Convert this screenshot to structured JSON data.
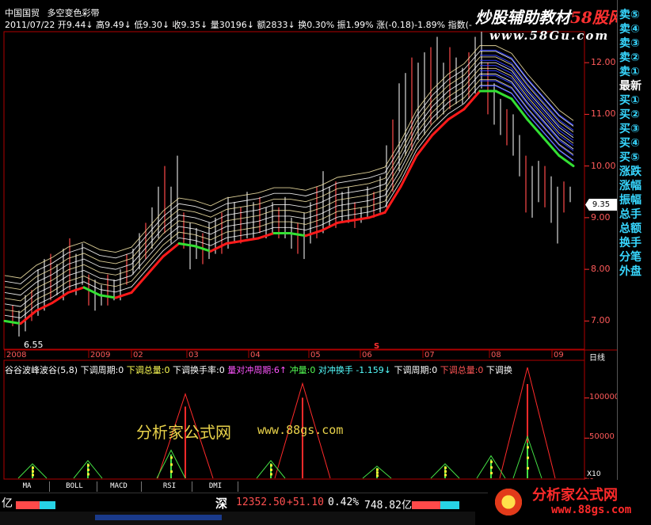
{
  "header": {
    "stock_name": "中国国贸",
    "indicator_name": "多空变色彩带",
    "date": "2011/07/22",
    "quote_parts": [
      "开9.44↓",
      "高9.49↓",
      "低9.30↓",
      "收9.35↓",
      "量30196↓",
      "额2833↓",
      "换0.30%",
      "振1.99%",
      "涨(-0.18)-1.89%",
      "指数(-"
    ]
  },
  "watermark_top": {
    "line1": "炒股辅助教材",
    "line1_red": "58股网",
    "line2": "www.58Gu.com"
  },
  "watermark_mid": {
    "brand": "分析家公式网",
    "url": "www.88gs.com"
  },
  "watermark_bottom": {
    "brand": "分析家公式网",
    "url": "www.88gs.com"
  },
  "price_axis": {
    "ticks": [
      "12.00",
      "11.00",
      "10.00",
      "9.00",
      "8.00",
      "7.00"
    ],
    "current": "9.35"
  },
  "low_label": "6.55",
  "date_axis": {
    "labels": [
      "2008",
      "2009",
      "02",
      "03",
      "04",
      "05",
      "06",
      "07",
      "08",
      "09"
    ],
    "period": "日线"
  },
  "marker_s": "S",
  "indicator_line": {
    "name": "谷谷波峰波谷(5,8)",
    "parts": [
      {
        "text": "下调周期:0",
        "color": "#ffffff"
      },
      {
        "text": "下调总量:0",
        "color": "#ffff55"
      },
      {
        "text": "下调换手率:0",
        "color": "#ffffff"
      },
      {
        "text": "量对冲周期:6↑",
        "color": "#ff55ff"
      },
      {
        "text": "冲量:0",
        "color": "#55ff55"
      },
      {
        "text": "对冲换手 -1.159↓",
        "color": "#55ffff"
      },
      {
        "text": "下调周期:0",
        "color": "#ffffff"
      },
      {
        "text": "下调总量:0",
        "color": "#ff5555"
      },
      {
        "text": "下调换",
        "color": "#ffffff"
      }
    ]
  },
  "volume_axis": {
    "ticks": [
      "100000",
      "50000",
      "0"
    ],
    "unit": "X10"
  },
  "tabs": [
    "MA",
    "BOLL",
    "MACD",
    "RSI",
    "DMI"
  ],
  "sidebar": [
    "卖⑤",
    "卖④",
    "卖③",
    "卖②",
    "卖①",
    "最新",
    "买①",
    "买②",
    "买③",
    "买④",
    "买⑤",
    "涨跌",
    "涨幅",
    "振幅",
    "总手",
    "总额",
    "换手",
    "分笔",
    "外盘"
  ],
  "status_bar": {
    "left": "亿",
    "market": "深",
    "index": "12352.50",
    "change": "+51.10",
    "pct": "0.42%",
    "amount": "748.82亿"
  },
  "chart_data": {
    "type": "line",
    "y_range": [
      6.5,
      12.6
    ],
    "main_line_points": [
      [
        0,
        7.0
      ],
      [
        20,
        6.95
      ],
      [
        40,
        7.2
      ],
      [
        60,
        7.35
      ],
      [
        80,
        7.55
      ],
      [
        100,
        7.65
      ],
      [
        120,
        7.5
      ],
      [
        140,
        7.45
      ],
      [
        160,
        7.55
      ],
      [
        180,
        7.9
      ],
      [
        200,
        8.25
      ],
      [
        220,
        8.5
      ],
      [
        240,
        8.45
      ],
      [
        260,
        8.35
      ],
      [
        280,
        8.5
      ],
      [
        300,
        8.55
      ],
      [
        320,
        8.6
      ],
      [
        340,
        8.7
      ],
      [
        360,
        8.7
      ],
      [
        380,
        8.65
      ],
      [
        400,
        8.75
      ],
      [
        420,
        8.9
      ],
      [
        440,
        8.95
      ],
      [
        460,
        9.0
      ],
      [
        480,
        9.1
      ],
      [
        500,
        9.6
      ],
      [
        520,
        10.2
      ],
      [
        540,
        10.6
      ],
      [
        560,
        10.9
      ],
      [
        580,
        11.1
      ],
      [
        600,
        11.45
      ],
      [
        620,
        11.45
      ],
      [
        640,
        11.3
      ],
      [
        660,
        10.9
      ],
      [
        680,
        10.55
      ],
      [
        700,
        10.2
      ],
      [
        718,
        10.0
      ]
    ],
    "band_count": 8,
    "band_spread": 0.11,
    "candles": [
      [
        10,
        6.9,
        7.3
      ],
      [
        18,
        6.7,
        7.2
      ],
      [
        26,
        6.8,
        7.5
      ],
      [
        34,
        7.0,
        7.6
      ],
      [
        42,
        7.1,
        8.0
      ],
      [
        50,
        7.2,
        8.2
      ],
      [
        58,
        7.4,
        8.3
      ],
      [
        66,
        7.5,
        8.1
      ],
      [
        74,
        7.4,
        8.4
      ],
      [
        82,
        7.6,
        8.6
      ],
      [
        90,
        7.5,
        8.3
      ],
      [
        98,
        7.7,
        8.5
      ],
      [
        106,
        7.3,
        7.9
      ],
      [
        114,
        7.2,
        7.8
      ],
      [
        122,
        7.3,
        7.7
      ],
      [
        130,
        7.3,
        7.9
      ],
      [
        138,
        7.4,
        7.8
      ],
      [
        146,
        7.4,
        8.0
      ],
      [
        154,
        7.7,
        8.3
      ],
      [
        162,
        7.9,
        8.4
      ],
      [
        170,
        8.0,
        8.7
      ],
      [
        178,
        8.2,
        8.9
      ],
      [
        186,
        8.4,
        9.2
      ],
      [
        194,
        8.6,
        9.6
      ],
      [
        202,
        8.7,
        10.0
      ],
      [
        210,
        8.5,
        9.6
      ],
      [
        218,
        8.6,
        10.2
      ],
      [
        226,
        8.4,
        9.1
      ],
      [
        234,
        8.0,
        8.9
      ],
      [
        242,
        8.2,
        8.8
      ],
      [
        250,
        8.1,
        8.7
      ],
      [
        258,
        8.2,
        8.9
      ],
      [
        266,
        8.3,
        9.0
      ],
      [
        274,
        8.3,
        9.1
      ],
      [
        282,
        8.4,
        9.4
      ],
      [
        290,
        8.5,
        9.3
      ],
      [
        298,
        8.5,
        9.2
      ],
      [
        306,
        8.6,
        9.5
      ],
      [
        314,
        8.6,
        9.3
      ],
      [
        322,
        8.7,
        9.4
      ],
      [
        330,
        8.6,
        9.2
      ],
      [
        338,
        8.7,
        9.3
      ],
      [
        346,
        8.6,
        9.2
      ],
      [
        354,
        8.6,
        9.4
      ],
      [
        362,
        8.4,
        9.0
      ],
      [
        370,
        8.3,
        8.9
      ],
      [
        378,
        8.2,
        9.1
      ],
      [
        386,
        8.5,
        9.3
      ],
      [
        394,
        8.6,
        9.6
      ],
      [
        402,
        8.7,
        9.9
      ],
      [
        410,
        8.8,
        9.6
      ],
      [
        418,
        8.8,
        9.7
      ],
      [
        426,
        8.9,
        9.5
      ],
      [
        434,
        8.9,
        9.6
      ],
      [
        442,
        8.8,
        9.3
      ],
      [
        450,
        8.9,
        9.2
      ],
      [
        458,
        9.0,
        9.6
      ],
      [
        466,
        9.0,
        9.5
      ],
      [
        474,
        9.1,
        9.8
      ],
      [
        482,
        9.2,
        10.4
      ],
      [
        490,
        9.5,
        10.9
      ],
      [
        498,
        9.9,
        11.6
      ],
      [
        506,
        10.2,
        11.8
      ],
      [
        514,
        10.3,
        12.1
      ],
      [
        522,
        10.5,
        12.0
      ],
      [
        530,
        10.6,
        12.2
      ],
      [
        538,
        10.8,
        12.3
      ],
      [
        546,
        10.9,
        12.5
      ],
      [
        554,
        11.0,
        12.0
      ],
      [
        562,
        11.1,
        12.3
      ],
      [
        570,
        11.2,
        12.1
      ],
      [
        578,
        11.2,
        11.9
      ],
      [
        586,
        11.3,
        12.2
      ],
      [
        594,
        11.4,
        12.5
      ],
      [
        602,
        11.5,
        12.6
      ],
      [
        610,
        11.0,
        12.0
      ],
      [
        618,
        10.8,
        11.6
      ],
      [
        626,
        10.6,
        11.3
      ],
      [
        634,
        10.4,
        11.1
      ],
      [
        642,
        10.2,
        11.0
      ],
      [
        650,
        9.8,
        10.6
      ],
      [
        658,
        9.1,
        10.2
      ],
      [
        666,
        9.0,
        10.0
      ],
      [
        674,
        9.3,
        10.1
      ],
      [
        682,
        9.2,
        10.0
      ],
      [
        690,
        8.9,
        9.8
      ],
      [
        698,
        8.5,
        9.6
      ],
      [
        706,
        9.1,
        9.7
      ],
      [
        714,
        9.3,
        9.6
      ]
    ],
    "volume_range": [
      0,
      140000
    ],
    "red_peaks": [
      [
        228,
        105000
      ],
      [
        376,
        118000
      ],
      [
        660,
        138000
      ]
    ],
    "green_peaks": [
      [
        35,
        18000
      ],
      [
        105,
        22000
      ],
      [
        210,
        35000
      ],
      [
        336,
        22000
      ],
      [
        470,
        15000
      ],
      [
        556,
        18000
      ],
      [
        614,
        28000
      ],
      [
        660,
        52000
      ]
    ]
  }
}
